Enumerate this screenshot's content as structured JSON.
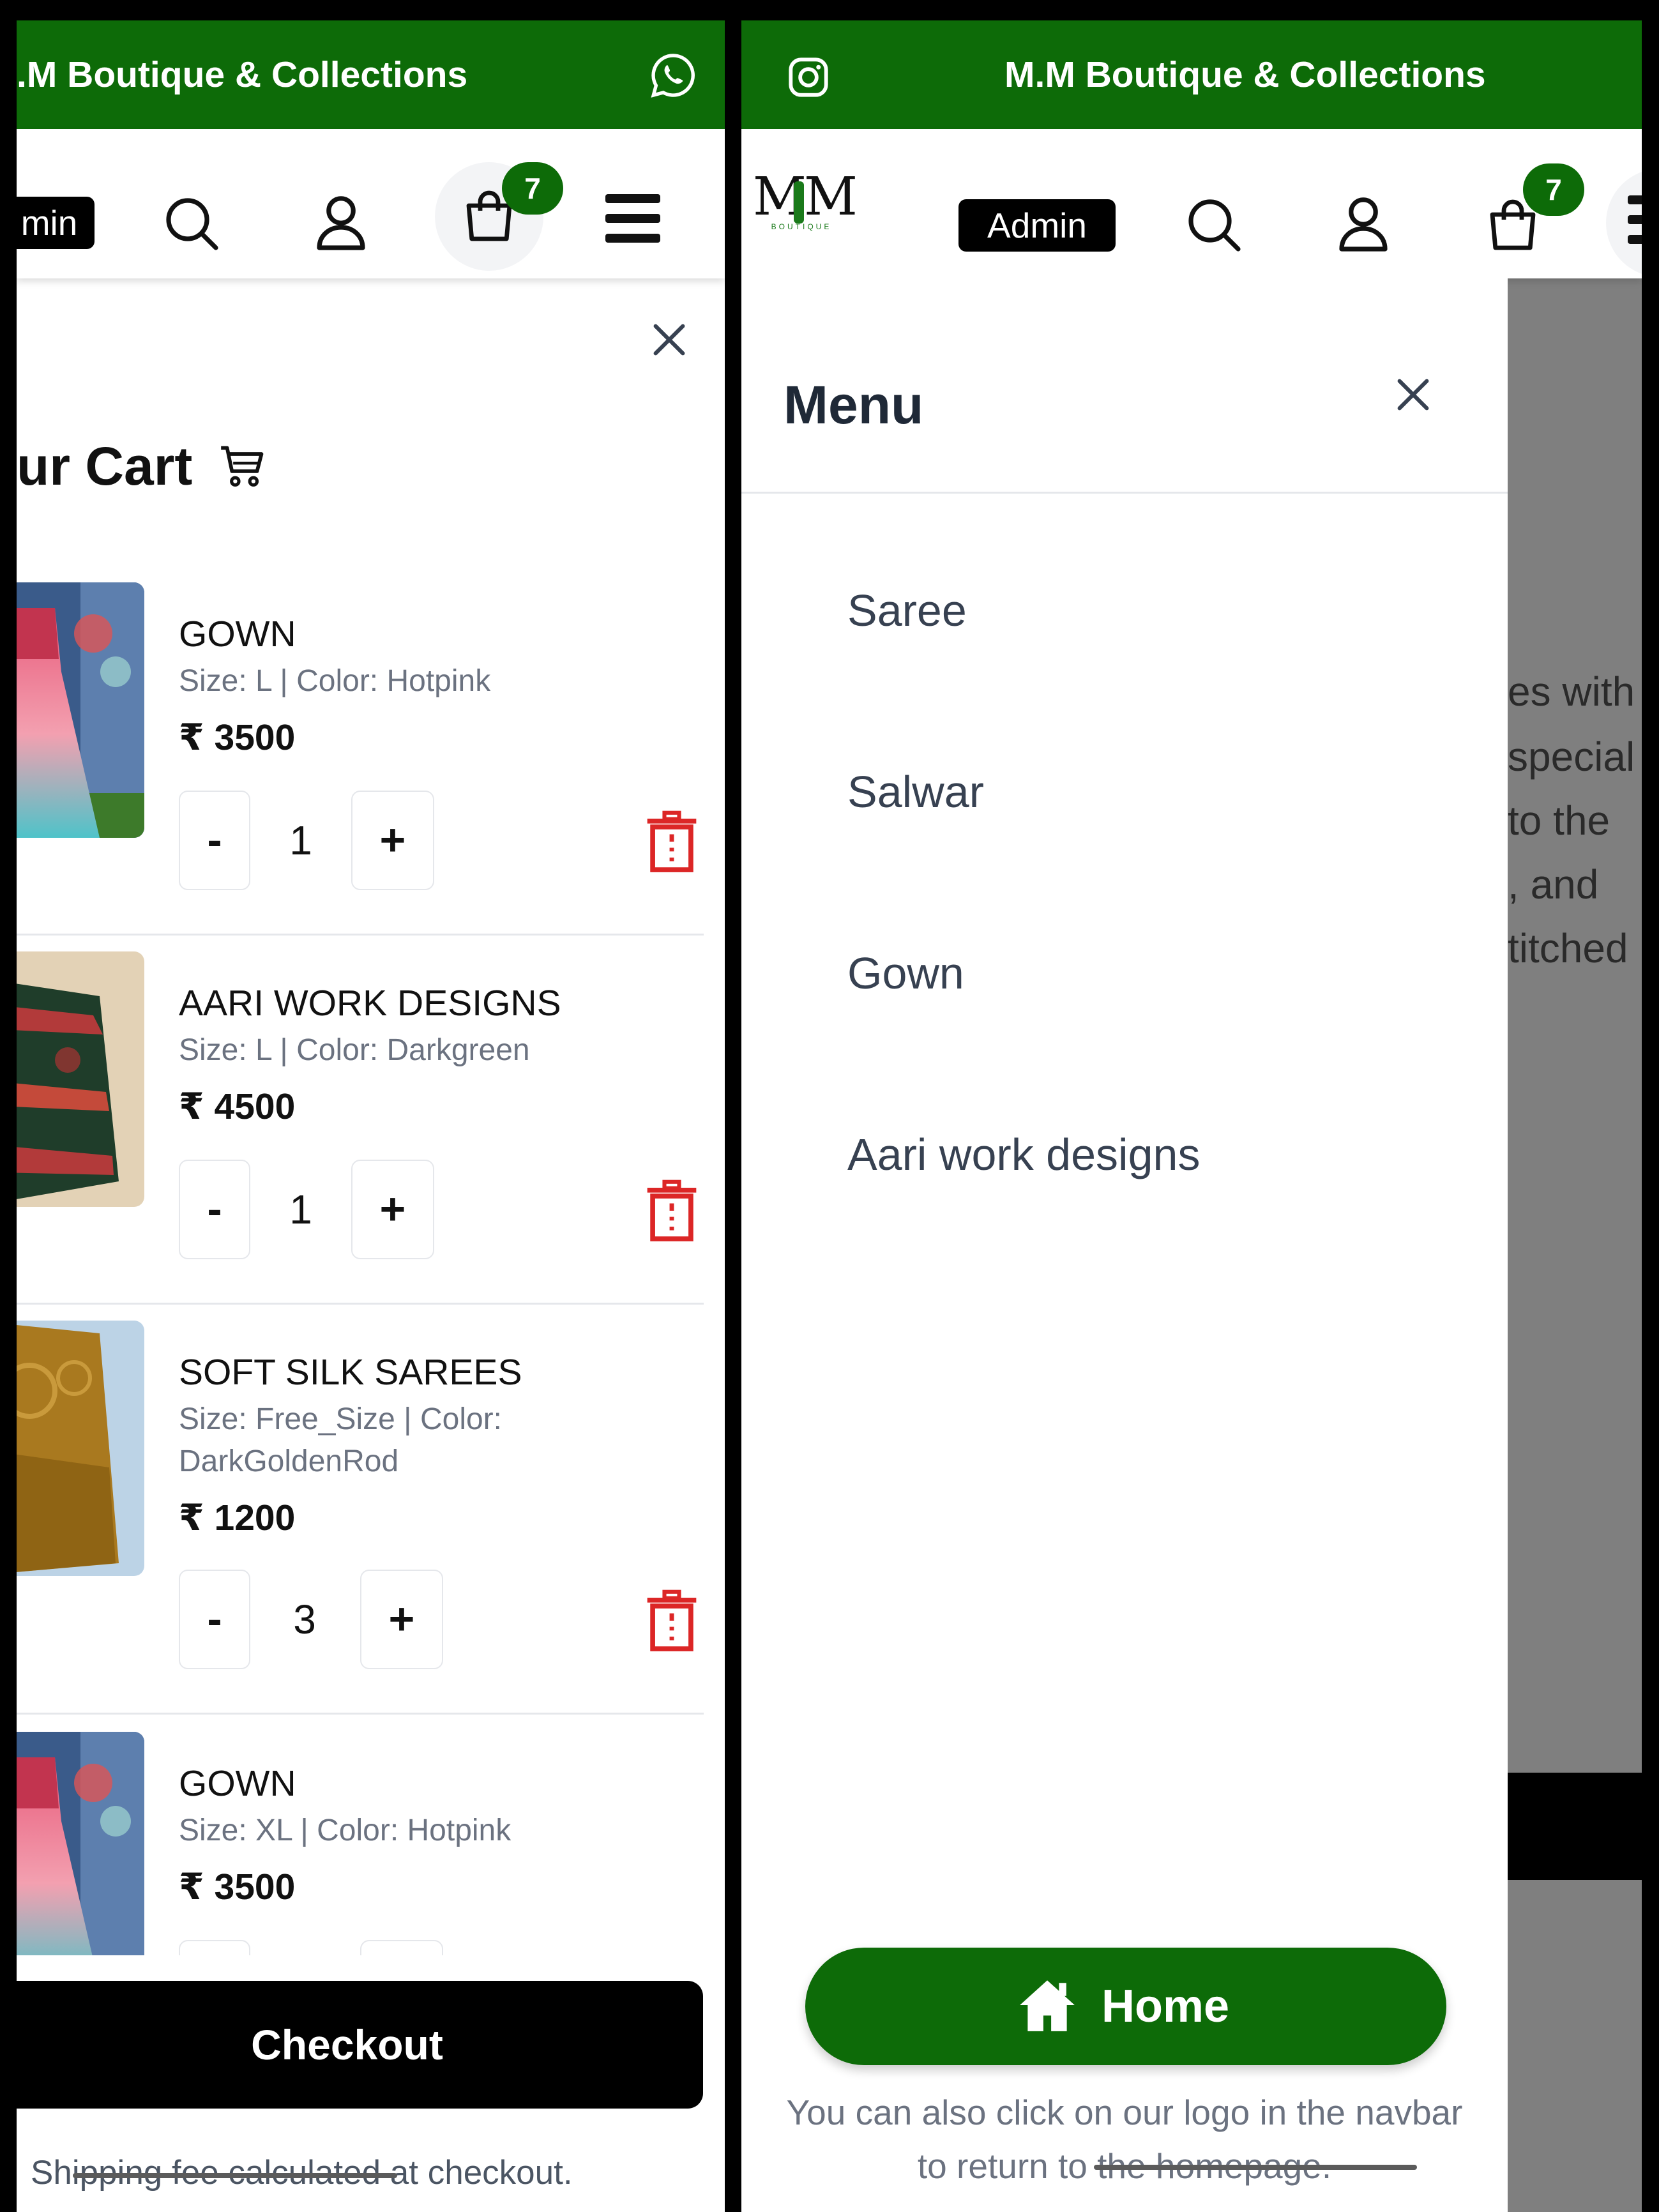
{
  "left_panel": {
    "brand": ".M Boutique & Collections",
    "admin_label": "min",
    "cart_count": "7",
    "cart_title": "ur Cart",
    "items": [
      {
        "name": "GOWN",
        "meta": "Size: L | Color: Hotpink",
        "price": "₹ 3500",
        "qty": "1"
      },
      {
        "name": "AARI WORK DESIGNS",
        "meta": "Size: L | Color: Darkgreen",
        "price": "₹ 4500",
        "qty": "1"
      },
      {
        "name": "SOFT SILK SAREES",
        "meta": "Size: Free_Size | Color: DarkGoldenRod",
        "price": "₹ 1200",
        "qty": "3"
      },
      {
        "name": "GOWN",
        "meta": "Size: XL | Color: Hotpink",
        "price": "₹ 3500"
      }
    ],
    "minus": "-",
    "plus": "+",
    "checkout": "Checkout",
    "shipping_note": "Shipping fee calculated at checkout."
  },
  "right_panel": {
    "brand": "M.M Boutique & Collections",
    "logo_text": "MM",
    "logo_sub": "BOUTIQUE",
    "admin_label": "Admin",
    "cart_count": "7",
    "menu_title": "Menu",
    "menu_items": [
      "Saree",
      "Salwar",
      "Gown",
      "Aari work designs"
    ],
    "home_label": "Home",
    "home_note": "You can also click on our logo in the navbar to return to the homepage.",
    "background_text": [
      "es with",
      "special",
      "to the",
      ", and",
      "titched"
    ]
  },
  "colors": {
    "brand_green": "#0d6b08",
    "delete_red": "#dc2626",
    "overlay_gray": "#7f7f7f"
  },
  "icons": [
    "whatsapp-icon",
    "instagram-icon",
    "search-icon",
    "user-icon",
    "shopping-bag-icon",
    "hamburger-icon",
    "close-icon",
    "cart-icon",
    "trash-icon",
    "home-icon"
  ]
}
